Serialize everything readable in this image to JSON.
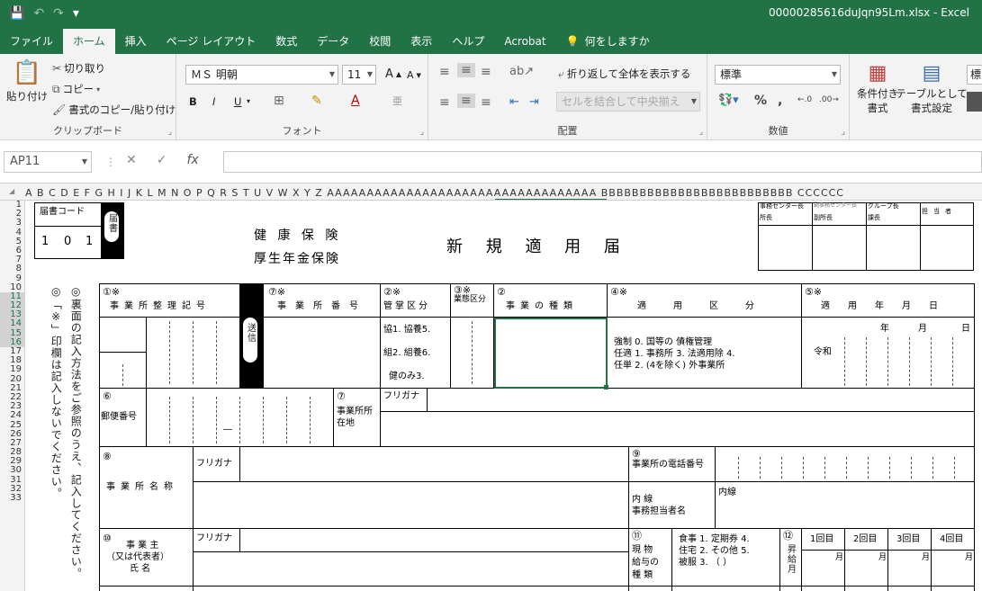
{
  "qat": {
    "save_icon": "save-icon",
    "undo_icon": "undo-icon",
    "redo_icon": "redo-icon",
    "customize_icon": "customize-icon"
  },
  "window": {
    "title": "00000285616duJqn95Lm.xlsx  -  Excel"
  },
  "tabs": [
    "ファイル",
    "ホーム",
    "挿入",
    "ページ レイアウト",
    "数式",
    "データ",
    "校閲",
    "表示",
    "ヘルプ",
    "Acrobat"
  ],
  "tell_me": "何をしますか",
  "ribbon": {
    "clipboard": {
      "paste": "貼り付け",
      "cut": "切り取り",
      "copy": "コピー",
      "format_painter": "書式のコピー/貼り付け",
      "label": "クリップボード"
    },
    "font": {
      "name": "ＭＳ 明朝",
      "size": "11",
      "label": "フォント",
      "bold": "B",
      "italic": "I",
      "underline": "U",
      "grow": "A",
      "shrink": "A",
      "font_color": "A"
    },
    "alignment": {
      "wrap": "折り返して全体を表示する",
      "merge": "セルを結合して中央揃え",
      "label": "配置"
    },
    "number": {
      "format": "標準",
      "label": "数値",
      "percent": "%",
      "comma": ","
    },
    "styles": {
      "conditional": "条件付き",
      "conditional2": "書式",
      "table": "テーブルとして",
      "table2": "書式設定",
      "cell_style": "標"
    }
  },
  "formula_bar": {
    "name_box": "AP11",
    "fx": "fx",
    "cancel": "✕",
    "enter": "✓"
  },
  "column_headers": "A B C D E F G H I J K L M N O P Q R S T U V W X Y Z AAAAAAAAAAAAAAAAAAAAAAAAAAAAAAAAAA BBBBBBBBBBBBBBBBBBBBBBBBB CCCCCC",
  "rows": [
    "1",
    "2",
    "3",
    "4",
    "5",
    "6",
    "7",
    "8",
    "9",
    "10",
    "11",
    "12",
    "13",
    "14",
    "15",
    "16",
    "17",
    "18",
    "19",
    "20",
    "21",
    "22",
    "23",
    "24",
    "25",
    "26",
    "27",
    "28",
    "29",
    "30",
    "31",
    "32",
    "33"
  ],
  "form": {
    "form_code_label": "届書コード",
    "form_code_digits": [
      "1",
      "0",
      "1"
    ],
    "form_code_tag": "届書",
    "health": "健 康 保 険",
    "pension": "厚生年金保険",
    "title": "新 規 適 用 届",
    "office_center": "事務センター長",
    "office_center2": "副事務センター長",
    "group_head": "グループ長",
    "person_in_charge": "担当者",
    "office_head": "所長",
    "vice_head": "副所長",
    "section_head": "課長",
    "side_note1": "◎裏面の記入方法をご参照のうえ、記入してください。",
    "side_note2": "◎「※」印欄は記入しないでください。",
    "h1": "①※",
    "h1_label": "事業所整理記号",
    "send": "送信",
    "h7a": "⑦※",
    "h7a_label": "事業所番号",
    "h2": "②※",
    "h2_label": "管掌区分",
    "h3": "③※",
    "h3_label": "業態区分",
    "h3b": "②",
    "h3b_label": "事業の種類",
    "h4": "④※",
    "h4_label": "適用区分",
    "h5": "⑤※",
    "h5_label": "適用年月日",
    "kanjo1": "協1. 協養5.",
    "kanjo2": "組2. 組養6.",
    "kanjo3": "健のみ3.",
    "tekiyo1": "強制 0. 国等の    債権管理",
    "tekiyo2": "任適 1. 事務所 3.   法適用除 4.",
    "tekiyo3": "任単 2. (4を除く)   外事業所",
    "year": "年",
    "month": "月",
    "day": "日",
    "reiwa": "令和",
    "h6": "⑥",
    "postal": "郵便番号",
    "dash": "―",
    "h7": "⑦",
    "address": "事業所所在地",
    "furigana": "フリガナ",
    "h8": "⑧",
    "office_name": "事業所名称",
    "h9": "⑨",
    "phone": "事業所の電話番号",
    "extension": "内線",
    "contact1": "内        線",
    "contact2": "事務担当者名",
    "h10": "⑩",
    "owner1": "事  業  主",
    "owner2": "（又は代表者）",
    "owner3": "氏    名",
    "h11": "⑪",
    "salary1": "現    物",
    "salary2": "給与の",
    "salary3": "種  類",
    "meal": "食事 1.  定期券 4.",
    "house": "住宅 2.  その他 5.",
    "cloth": "被服 3.  （          ）",
    "h12": "⑫",
    "raise": "昇給月",
    "first": "1回目",
    "second": "2回目",
    "third": "3回目",
    "fourth": "4回目",
    "tsuki": "月"
  }
}
